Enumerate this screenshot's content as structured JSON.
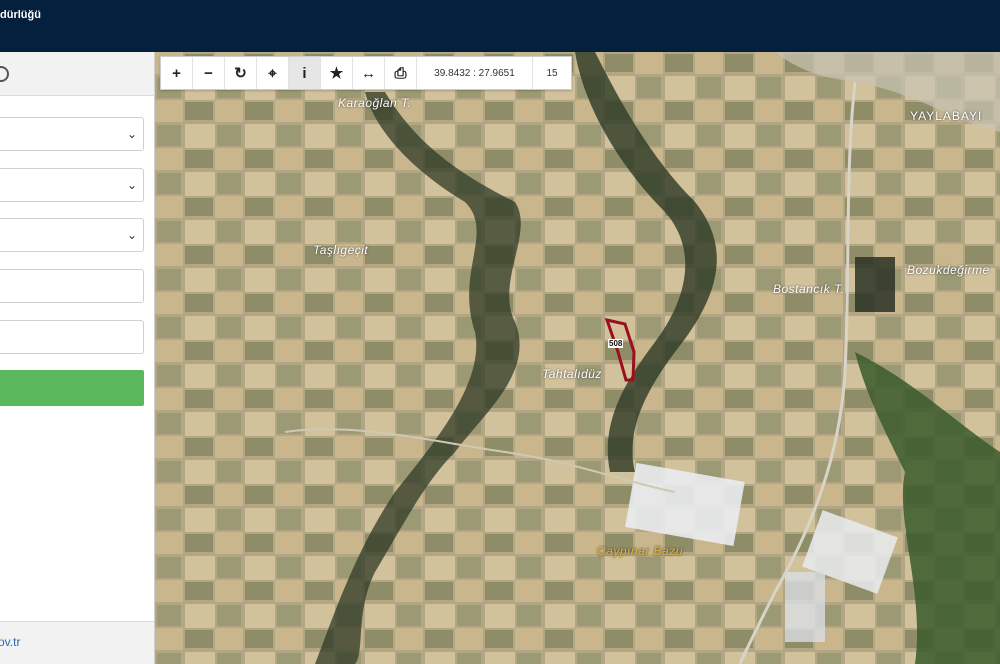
{
  "header": {
    "title": "dürlüğü"
  },
  "sidebar": {
    "footer_link": "ov.tr",
    "selects": [
      {
        "value": "",
        "chevron": "⌄"
      },
      {
        "value": "",
        "chevron": "⌄"
      },
      {
        "value": "",
        "chevron": "⌄"
      }
    ],
    "inputs": [
      {
        "value": ""
      },
      {
        "value": ""
      }
    ],
    "submit_label": ""
  },
  "toolbar": {
    "tools": [
      {
        "icon": "zoom-in-icon",
        "glyph": "+"
      },
      {
        "icon": "zoom-out-icon",
        "glyph": "−"
      },
      {
        "icon": "refresh-icon",
        "glyph": "↻"
      },
      {
        "icon": "locate-icon",
        "glyph": "⌖"
      },
      {
        "icon": "info-icon",
        "glyph": "i"
      },
      {
        "icon": "star-icon",
        "glyph": "★"
      },
      {
        "icon": "measure-icon",
        "glyph": "↔"
      },
      {
        "icon": "print-icon",
        "glyph": "⎙"
      }
    ],
    "coordinates": "39.8432 : 27.9651",
    "zoom_level": "15"
  },
  "map": {
    "places": [
      {
        "name": "Karaoğlan T."
      },
      {
        "name": "Taşlıgeçit"
      },
      {
        "name": "Tahtalıdüz"
      },
      {
        "name": "Bostancık T."
      },
      {
        "name": "Bozukdeğirme"
      },
      {
        "name": "YAYLABAYI"
      },
      {
        "name": "Çaypınar Bazu"
      }
    ],
    "parcel_label": "508",
    "colors": {
      "parcel_outline": "#9b0f1e",
      "header_bg": "#05203d",
      "submit_bg": "#5cb85c"
    }
  }
}
